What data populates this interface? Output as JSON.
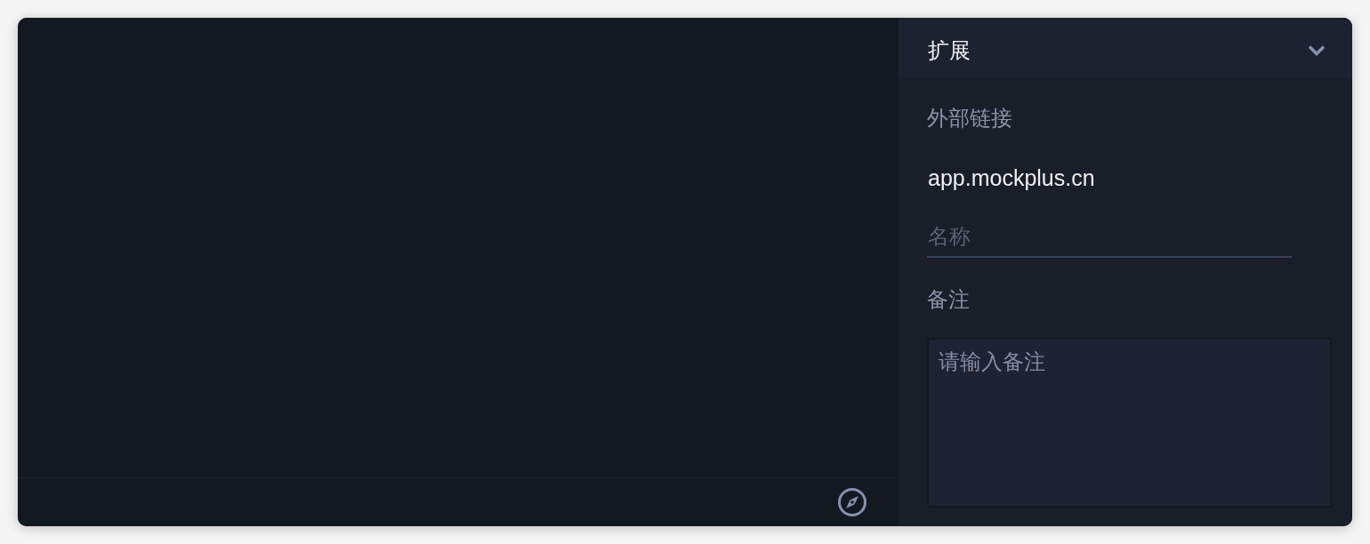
{
  "panel": {
    "title": "扩展",
    "expanded": true,
    "fields": [
      {
        "kind": "label",
        "text": "外部链接"
      },
      {
        "kind": "value",
        "value": "app.mockplus.cn"
      },
      {
        "kind": "underline-input",
        "placeholder": "名称"
      },
      {
        "kind": "label",
        "text": "备注"
      },
      {
        "kind": "textarea",
        "placeholder": "请输入备注"
      }
    ]
  }
}
